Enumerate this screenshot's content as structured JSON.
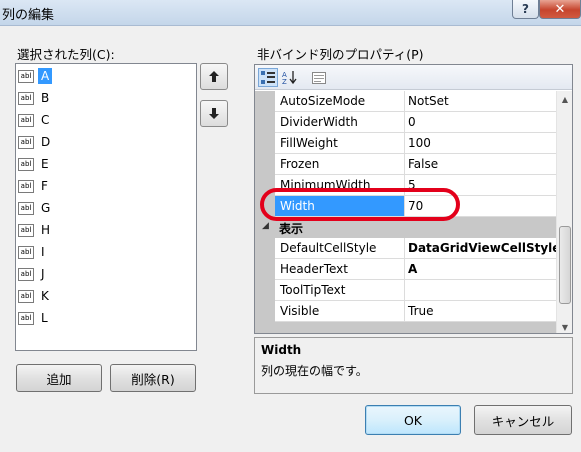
{
  "window": {
    "title": "列の編集",
    "help_label": "?",
    "close_label": "✕"
  },
  "left_panel": {
    "label": "選択された列(C):",
    "columns": [
      {
        "icon_text": "abl",
        "name": "A",
        "selected": true
      },
      {
        "icon_text": "abl",
        "name": "B"
      },
      {
        "icon_text": "abl",
        "name": "C"
      },
      {
        "icon_text": "abl",
        "name": "D"
      },
      {
        "icon_text": "abl",
        "name": "E"
      },
      {
        "icon_text": "abl",
        "name": "F"
      },
      {
        "icon_text": "abl",
        "name": "G"
      },
      {
        "icon_text": "abl",
        "name": "H"
      },
      {
        "icon_text": "abl",
        "name": "I"
      },
      {
        "icon_text": "abl",
        "name": "J"
      },
      {
        "icon_text": "abl",
        "name": "K"
      },
      {
        "icon_text": "abl",
        "name": "L"
      }
    ],
    "move_up_icon": "arrow-up-icon",
    "move_down_icon": "arrow-down-icon",
    "add_label": "追加",
    "remove_label": "削除(R)"
  },
  "right_panel": {
    "label": "非バインド列のプロパティ(P)",
    "toolbar": {
      "categorized_icon": "categorized-icon",
      "alphabetical_icon": "alphabetical-sort-icon",
      "property_pages_icon": "property-pages-icon"
    },
    "rows": [
      {
        "name": "AutoSizeMode",
        "value": "NotSet"
      },
      {
        "name": "DividerWidth",
        "value": "0"
      },
      {
        "name": "FillWeight",
        "value": "100"
      },
      {
        "name": "Frozen",
        "value": "False"
      },
      {
        "name": "MinimumWidth",
        "value": "5"
      },
      {
        "name": "Width",
        "value": "70",
        "selected": true
      }
    ],
    "category": {
      "toggle": "◢",
      "name": "表示"
    },
    "category_rows": [
      {
        "name": "DefaultCellStyle",
        "value": "DataGridViewCellStyle",
        "bold": true
      },
      {
        "name": "HeaderText",
        "value": "A",
        "bold": true
      },
      {
        "name": "ToolTipText",
        "value": ""
      },
      {
        "name": "Visible",
        "value": "True"
      }
    ],
    "description": {
      "title": "Width",
      "text": "列の現在の幅です。"
    }
  },
  "footer": {
    "ok_label": "OK",
    "cancel_label": "キャンセル"
  },
  "colors": {
    "selection": "#3399ff",
    "highlight_oval": "#e3001b"
  }
}
